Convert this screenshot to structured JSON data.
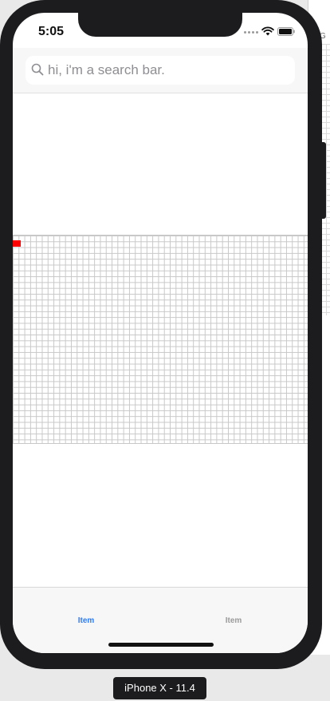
{
  "status_bar": {
    "time": "5:05"
  },
  "search": {
    "placeholder": "hi, i'm a search bar.",
    "value": ""
  },
  "background_window": {
    "partial_label": "G"
  },
  "tab_bar": {
    "items": [
      {
        "label": "Item",
        "selected": true
      },
      {
        "label": "Item",
        "selected": false
      }
    ]
  },
  "simulator": {
    "device_label": "iPhone X - 11.4"
  },
  "colors": {
    "accent": "#2f7cf6",
    "marker": "#ff0000",
    "tab_inactive": "#9b9b9b"
  },
  "icons": {
    "search": "search-icon",
    "wifi": "wifi-icon",
    "battery": "battery-icon"
  }
}
